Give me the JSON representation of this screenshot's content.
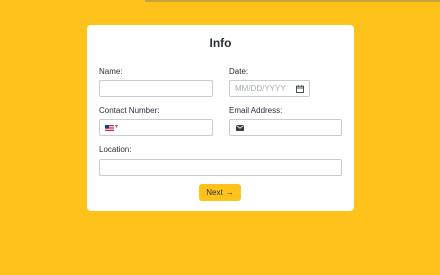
{
  "form": {
    "title": "Info",
    "name_label": "Name:",
    "name_value": "",
    "date_label": "Date:",
    "date_placeholder": "MM/DD/YYYY",
    "contact_label": "Contact Number:",
    "contact_value": "",
    "email_label": "Email Address:",
    "email_value": "",
    "location_label": "Location:",
    "location_value": "",
    "next_label": "Next",
    "next_arrow": "→"
  },
  "icons": {
    "calendar": "calendar-icon",
    "flag": "us-flag-icon",
    "mail": "mail-icon"
  },
  "colors": {
    "background": "#FFC21A",
    "button": "#FFC21A",
    "card": "#FFFFFF"
  }
}
